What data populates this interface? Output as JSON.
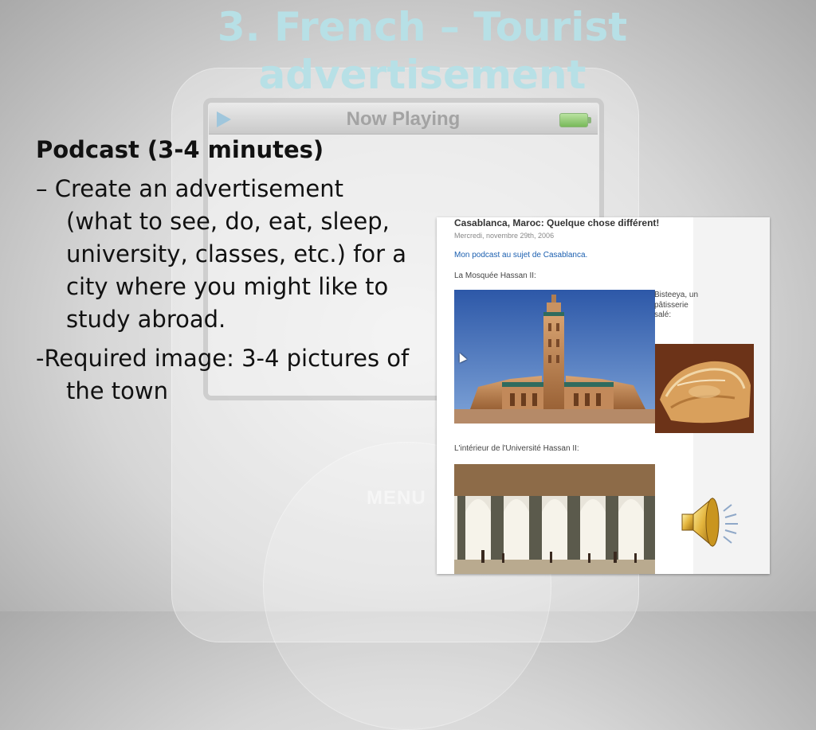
{
  "slide": {
    "title": "3. French – Tourist advertisement",
    "heading": "Podcast (3-4 minutes)",
    "items": [
      "– Create an advertisement (what to see, do, eat, sleep, university, classes, etc.) for a city where you might like to study abroad.",
      "-Required image: 3-4 pictures of the town"
    ]
  },
  "ipod": {
    "screen_title": "Now Playing",
    "menu_label": "MENU"
  },
  "blog": {
    "post_title": "Casablanca, Maroc: Quelque chose différent!",
    "post_date": "Mercredi, novembre 29th, 2006",
    "podcast_link": "Mon podcast au sujet de Casablanca.",
    "caption_mosque": "La Mosquée Hassan II:",
    "caption_pastry": "Bisteeya, un pâtisserie salé:",
    "caption_university": "L'intérieur de l'Université Hassan II:"
  },
  "icons": {
    "speaker": "speaker-icon",
    "play": "play-icon",
    "battery": "battery-icon",
    "cursor": "cursor-icon"
  },
  "colors": {
    "title": "#b7e0e6",
    "link": "#1b5fb0"
  }
}
